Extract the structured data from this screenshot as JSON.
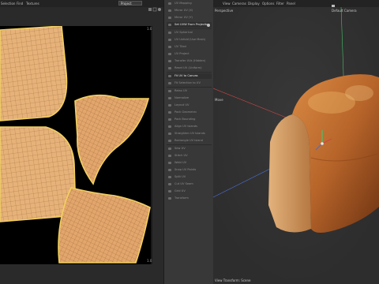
{
  "uv_editor": {
    "menu": [
      "Selection",
      "Find",
      "Textures"
    ],
    "project_select": "Project",
    "corner_top_right": "1.0",
    "corner_bottom_right": "1.0"
  },
  "uv_menu": {
    "items": [
      {
        "label": "UV Mapping",
        "active": false,
        "cog": false
      },
      {
        "label": "Mirror UV (X)",
        "active": false,
        "cog": false
      },
      {
        "label": "Mirror UV (Y)",
        "active": false,
        "cog": false
      },
      {
        "label": "Set UVW From Projection",
        "active": true,
        "cog": true
      },
      {
        "label": "UV Spherical",
        "active": false,
        "cog": false
      },
      {
        "label": "UV Unfold (Use Mesh)",
        "active": false,
        "cog": false
      },
      {
        "label": "UV Tiled",
        "active": false,
        "cog": false
      },
      {
        "label": "UV Project",
        "active": false,
        "cog": false
      },
      {
        "label": "Transfer UVs (Hidden)",
        "active": false,
        "cog": false
      },
      {
        "label": "Reset UV (Uniform)",
        "active": false,
        "cog": false
      },
      {
        "label": "Fit UV to Canvas",
        "active": true,
        "cog": false
      },
      {
        "label": "Fit Selection to UV",
        "active": false,
        "cog": false
      },
      {
        "label": "Relax UV",
        "active": false,
        "cog": false
      },
      {
        "label": "Normalize",
        "active": false,
        "cog": false
      },
      {
        "label": "Layout UV",
        "active": false,
        "cog": false
      },
      {
        "label": "Pack Geometric",
        "active": false,
        "cog": false
      },
      {
        "label": "Pack Bounding",
        "active": false,
        "cog": false
      },
      {
        "label": "Align UV Islands",
        "active": false,
        "cog": false
      },
      {
        "label": "Straighten UV Islands",
        "active": false,
        "cog": false
      },
      {
        "label": "Rectangle UV Island",
        "active": false,
        "cog": false
      },
      {
        "label": "Sew UV",
        "active": false,
        "cog": false
      },
      {
        "label": "Stitch UV",
        "active": false,
        "cog": false
      },
      {
        "label": "Weld UV",
        "active": false,
        "cog": false
      },
      {
        "label": "Snap UV Points",
        "active": false,
        "cog": false
      },
      {
        "label": "Split UV",
        "active": false,
        "cog": false
      },
      {
        "label": "Cut UV Seam",
        "active": false,
        "cog": false
      },
      {
        "label": "Grid UV",
        "active": false,
        "cog": false
      },
      {
        "label": "Transform",
        "active": false,
        "cog": false
      }
    ]
  },
  "viewport": {
    "menu": [
      "View",
      "Cameras",
      "Display",
      "Options",
      "Filter",
      "Panel"
    ],
    "perspective_label": "Perspective",
    "camera_label": "Default Camera",
    "move_label": "Move",
    "status_label": "View Transform: Scene"
  },
  "colors": {
    "uv_fill": "#e7b27a",
    "uv_line": "#9a6a3a",
    "uv_border": "#f2d060",
    "bread_crust": "#b8652a",
    "axis_x": "#d04545",
    "axis_y": "#45c06a",
    "axis_z": "#4a6ed0"
  }
}
